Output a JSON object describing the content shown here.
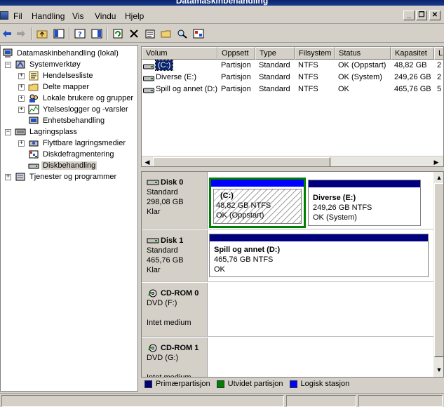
{
  "window": {
    "title": "Datamaskinbehandling"
  },
  "menu": [
    "Fil",
    "Handling",
    "Vis",
    "Vindu",
    "Hjelp"
  ],
  "tree": {
    "root": "Datamaskinbehandling (lokal)",
    "items": [
      {
        "label": "Systemverktøy",
        "level": 1,
        "expander": "−"
      },
      {
        "label": "Hendelsesliste",
        "level": 2,
        "expander": "+"
      },
      {
        "label": "Delte mapper",
        "level": 2,
        "expander": "+"
      },
      {
        "label": "Lokale brukere og grupper",
        "level": 2,
        "expander": "+"
      },
      {
        "label": "Ytelseslogger og -varsler",
        "level": 2,
        "expander": "+"
      },
      {
        "label": "Enhetsbehandling",
        "level": 2,
        "expander": ""
      },
      {
        "label": "Lagringsplass",
        "level": 1,
        "expander": "−"
      },
      {
        "label": "Flyttbare lagringsmedier",
        "level": 2,
        "expander": "+"
      },
      {
        "label": "Diskdefragmentering",
        "level": 2,
        "expander": ""
      },
      {
        "label": "Diskbehandling",
        "level": 2,
        "expander": "",
        "selected": true
      },
      {
        "label": "Tjenester og programmer",
        "level": 1,
        "expander": "+"
      }
    ]
  },
  "volumes": {
    "columns": [
      "Volum",
      "Oppsett",
      "Type",
      "Filsystem",
      "Status",
      "Kapasitet",
      "L"
    ],
    "rows": [
      [
        "(C:)",
        "Partisjon",
        "Standard",
        "NTFS",
        "OK (Oppstart)",
        "48,82 GB",
        "2"
      ],
      [
        "Diverse (E:)",
        "Partisjon",
        "Standard",
        "NTFS",
        "OK (System)",
        "249,26 GB",
        "2"
      ],
      [
        "Spill og annet (D:)",
        "Partisjon",
        "Standard",
        "NTFS",
        "OK",
        "465,76 GB",
        "5"
      ]
    ]
  },
  "disks": [
    {
      "name": "Disk 0",
      "type": "Standard",
      "size": "298,08 GB",
      "state": "Klar",
      "partitions": [
        {
          "name": "(C:)",
          "size": "48,82 GB NTFS",
          "status": "OK (Oppstart)"
        },
        {
          "name": "Diverse  (E:)",
          "size": "249,26 GB NTFS",
          "status": "OK (System)"
        }
      ]
    },
    {
      "name": "Disk 1",
      "type": "Standard",
      "size": "465,76 GB",
      "state": "Klar",
      "partitions": [
        {
          "name": "Spill og annet  (D:)",
          "size": "465,76 GB NTFS",
          "status": "OK"
        }
      ]
    },
    {
      "name": "CD-ROM 0",
      "type": "DVD (F:)",
      "state": "Intet medium"
    },
    {
      "name": "CD-ROM 1",
      "type": "DVD (G:)",
      "state": "Intet medium"
    }
  ],
  "legend": [
    "Primærpartisjon",
    "Utvidet partisjon",
    "Logisk stasjon"
  ],
  "colors": {
    "primary": "#00007f",
    "extended": "#008000",
    "logical": "#0000ff",
    "selection_bar": "#0000ff"
  }
}
